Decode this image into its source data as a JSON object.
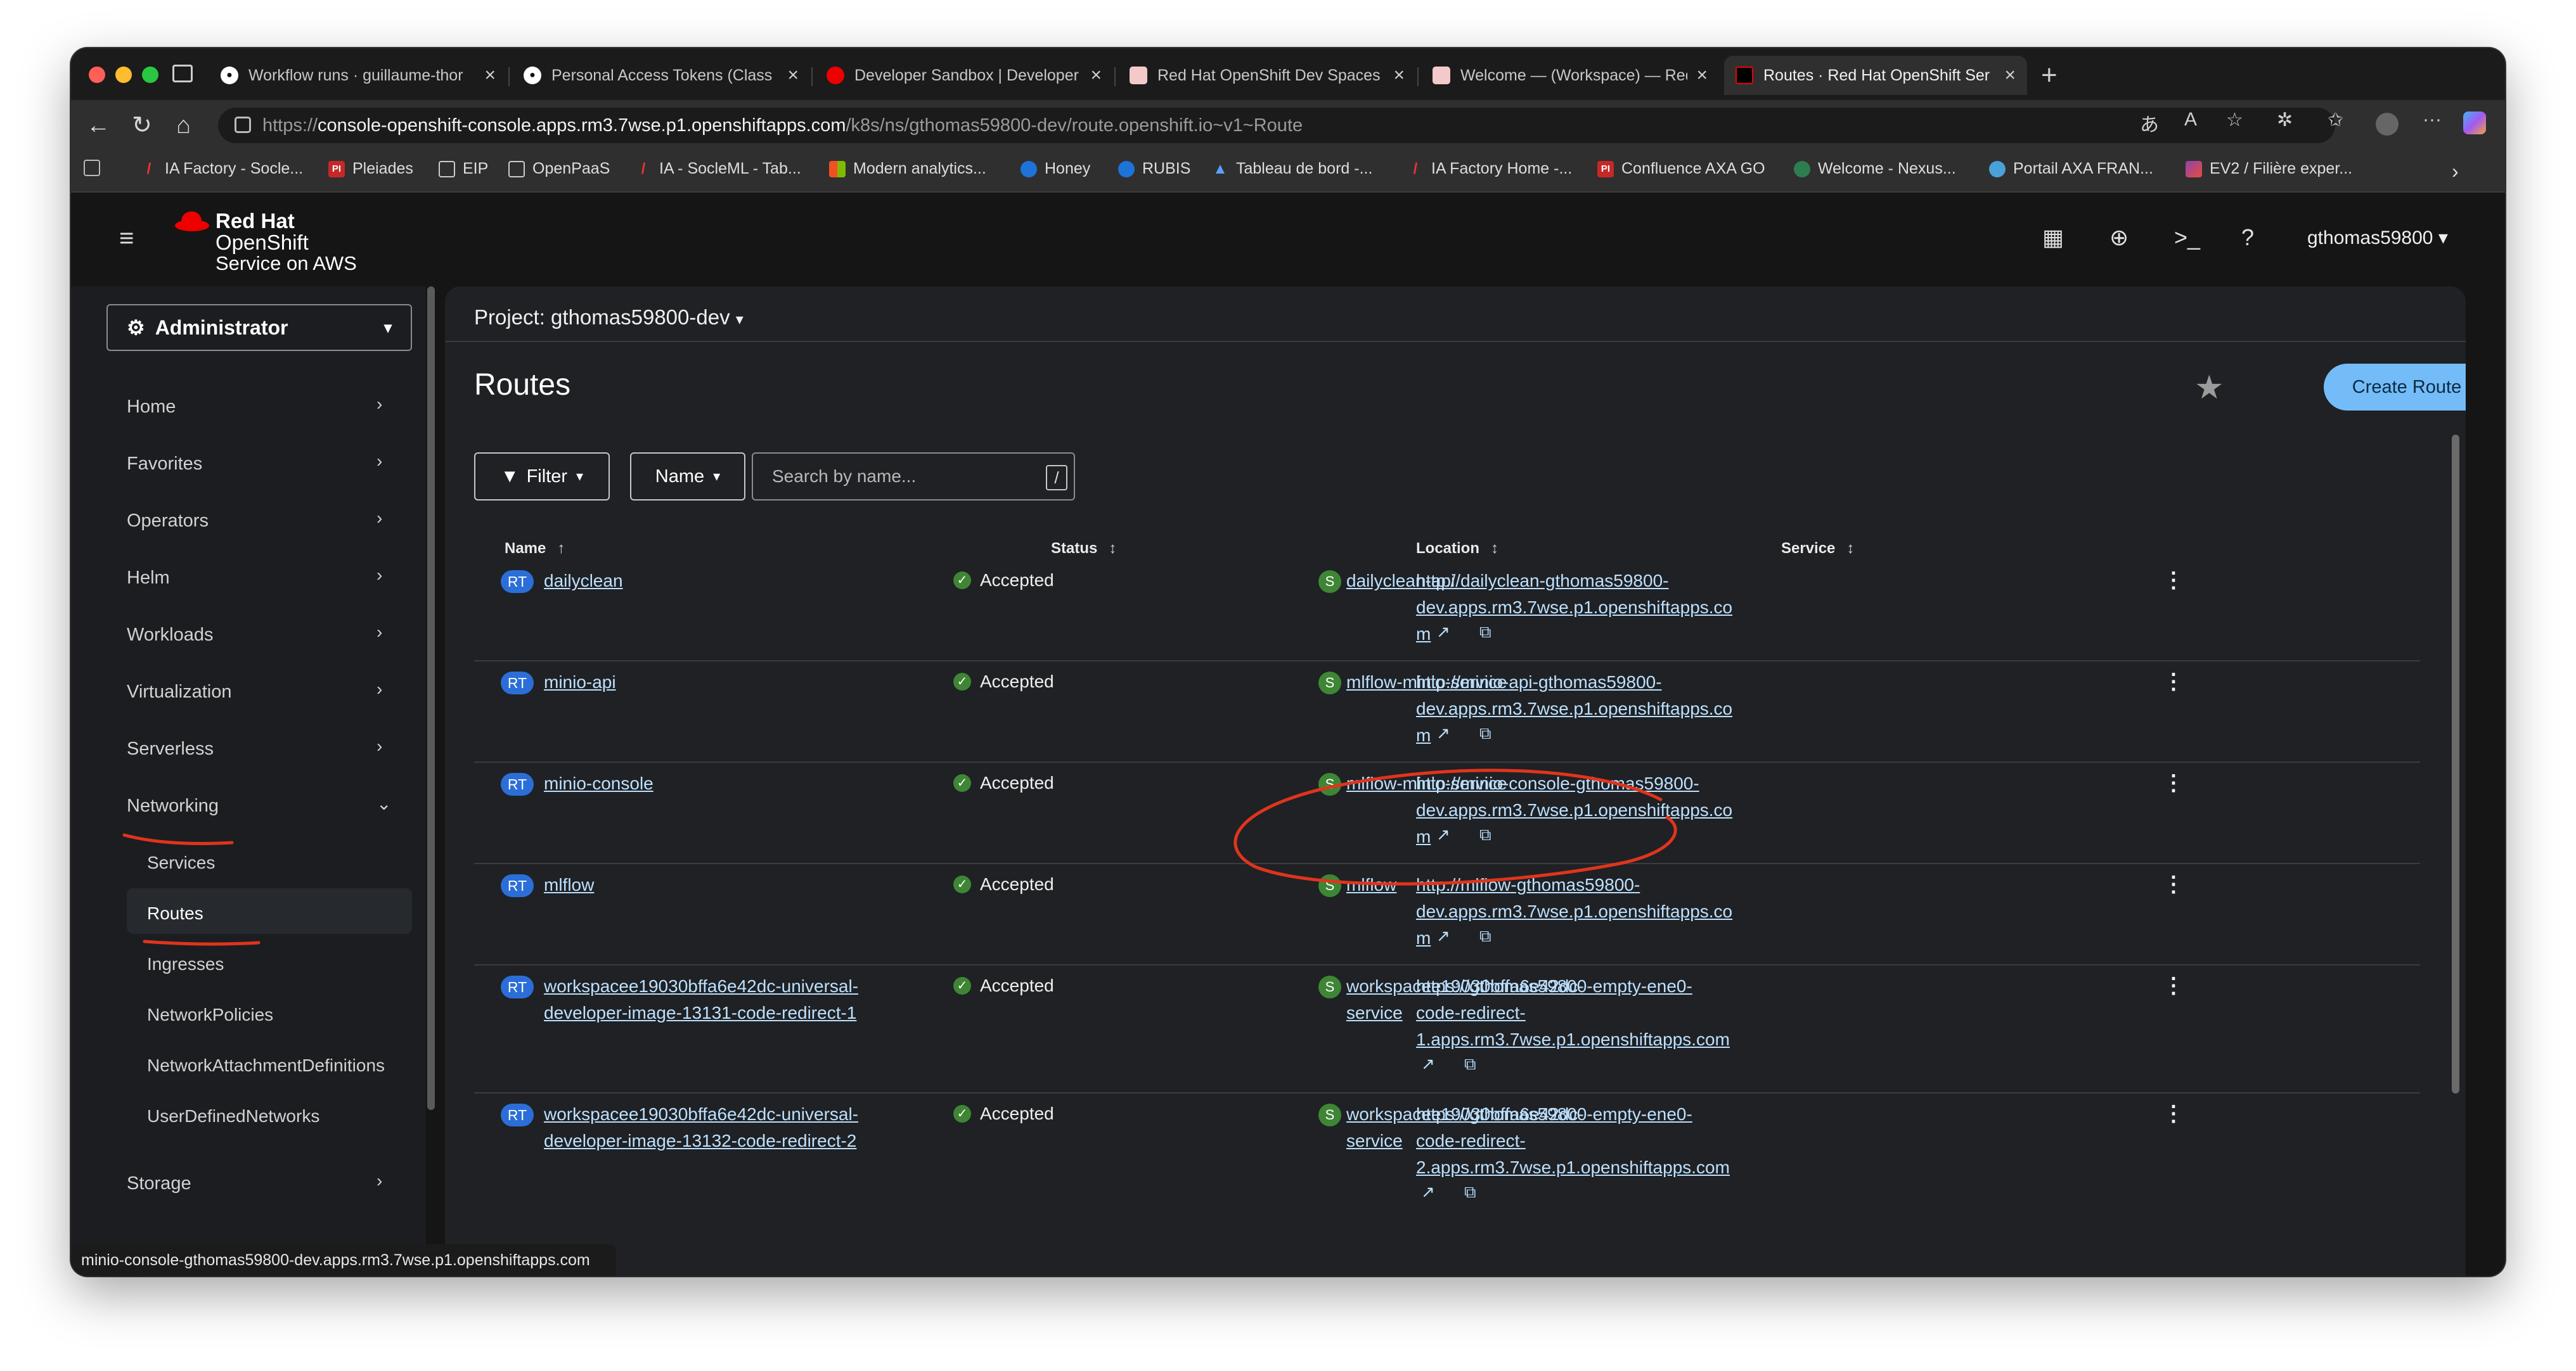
{
  "tabs": [
    {
      "title": "Workflow runs · guillaume-thor",
      "icon": "github-icon"
    },
    {
      "title": "Personal Access Tokens (Class",
      "icon": "github-icon"
    },
    {
      "title": "Developer Sandbox | Developer",
      "icon": "redhat-icon"
    },
    {
      "title": "Red Hat OpenShift Dev Spaces",
      "icon": "devspaces-icon"
    },
    {
      "title": "Welcome — (Workspace) — Red",
      "icon": "devspaces-icon"
    },
    {
      "title": "Routes · Red Hat OpenShift Ser",
      "icon": "openshift-icon"
    }
  ],
  "address": {
    "scheme": "https://",
    "host": "console-openshift-console.apps.rm3.7wse.p1.openshiftapps.com",
    "path": "/k8s/ns/gthomas59800-dev/route.openshift.io~v1~Route"
  },
  "bookmarks": [
    "IA Factory - Socle...",
    "Pleiades",
    "EIP",
    "OpenPaaS",
    "IA - SocleML - Tab...",
    "Modern analytics...",
    "Honey",
    "RUBIS",
    "Tableau de bord -...",
    "IA Factory Home -...",
    "Confluence AXA GO",
    "Welcome - Nexus...",
    "Portail AXA FRAN...",
    "EV2 / Filière exper..."
  ],
  "masthead": {
    "logo_line1": "Red Hat",
    "logo_line2": "OpenShift",
    "logo_line3": "Service on AWS",
    "user": "gthomas59800"
  },
  "sidebar": {
    "perspective": "Administrator",
    "items": [
      "Home",
      "Favorites",
      "Operators",
      "Helm",
      "Workloads",
      "Virtualization",
      "Serverless",
      "Networking"
    ],
    "networking_children": [
      "Services",
      "Routes",
      "Ingresses",
      "NetworkPolicies",
      "NetworkAttachmentDefinitions",
      "UserDefinedNetworks"
    ],
    "storage": "Storage"
  },
  "main": {
    "project": "Project: gthomas59800-dev",
    "title": "Routes",
    "create_button": "Create Route",
    "filter_label": "Filter",
    "name_label": "Name",
    "search_placeholder": "Search by name...",
    "search_shortcut": "/",
    "columns": {
      "name": "Name",
      "status": "Status",
      "location": "Location",
      "service": "Service"
    }
  },
  "rows": [
    {
      "badge": "RT",
      "name": [
        "dailyclean"
      ],
      "status": "Accepted",
      "location": [
        "http://dailyclean-gthomas59800-",
        "dev.apps.rm3.7wse.p1.openshiftapps.co",
        "m"
      ],
      "service": [
        "dailyclean-api"
      ]
    },
    {
      "badge": "RT",
      "name": [
        "minio-api"
      ],
      "status": "Accepted",
      "location": [
        "http://minio-api-gthomas59800-",
        "dev.apps.rm3.7wse.p1.openshiftapps.co",
        "m"
      ],
      "service": [
        "mlflow-minio-service"
      ]
    },
    {
      "badge": "RT",
      "name": [
        "minio-console"
      ],
      "status": "Accepted",
      "location": [
        "http://minio-console-gthomas59800-",
        "dev.apps.rm3.7wse.p1.openshiftapps.co",
        "m"
      ],
      "service": [
        "mlflow-minio-service"
      ]
    },
    {
      "badge": "RT",
      "name": [
        "mlflow"
      ],
      "status": "Accepted",
      "location": [
        "http://mlflow-gthomas59800-",
        "dev.apps.rm3.7wse.p1.openshiftapps.co",
        "m"
      ],
      "service": [
        "mlflow"
      ]
    },
    {
      "badge": "RT",
      "name": [
        "workspacee19030bffa6e42dc-universal-",
        "developer-image-13131-code-redirect-1"
      ],
      "status": "Accepted",
      "location": [
        "https://gthomas59800-empty-ene0-",
        "code-redirect-",
        "1.apps.rm3.7wse.p1.openshiftapps.com"
      ],
      "service": [
        "workspacee19030bffa6e42dc-",
        "service"
      ]
    },
    {
      "badge": "RT",
      "name": [
        "workspacee19030bffa6e42dc-universal-",
        "developer-image-13132-code-redirect-2"
      ],
      "status": "Accepted",
      "location": [
        "https://gthomas59800-empty-ene0-",
        "code-redirect-",
        "2.apps.rm3.7wse.p1.openshiftapps.com"
      ],
      "service": [
        "workspacee19030bffa6e42dc-",
        "service"
      ]
    }
  ],
  "status_bar": "minio-console-gthomas59800-dev.apps.rm3.7wse.p1.openshiftapps.com",
  "colors": {
    "accent": "#73bcf7",
    "link": "#bde0ff",
    "success": "#3e8635",
    "annotation": "#e0341c",
    "rt_badge": "#2b6ed8"
  }
}
